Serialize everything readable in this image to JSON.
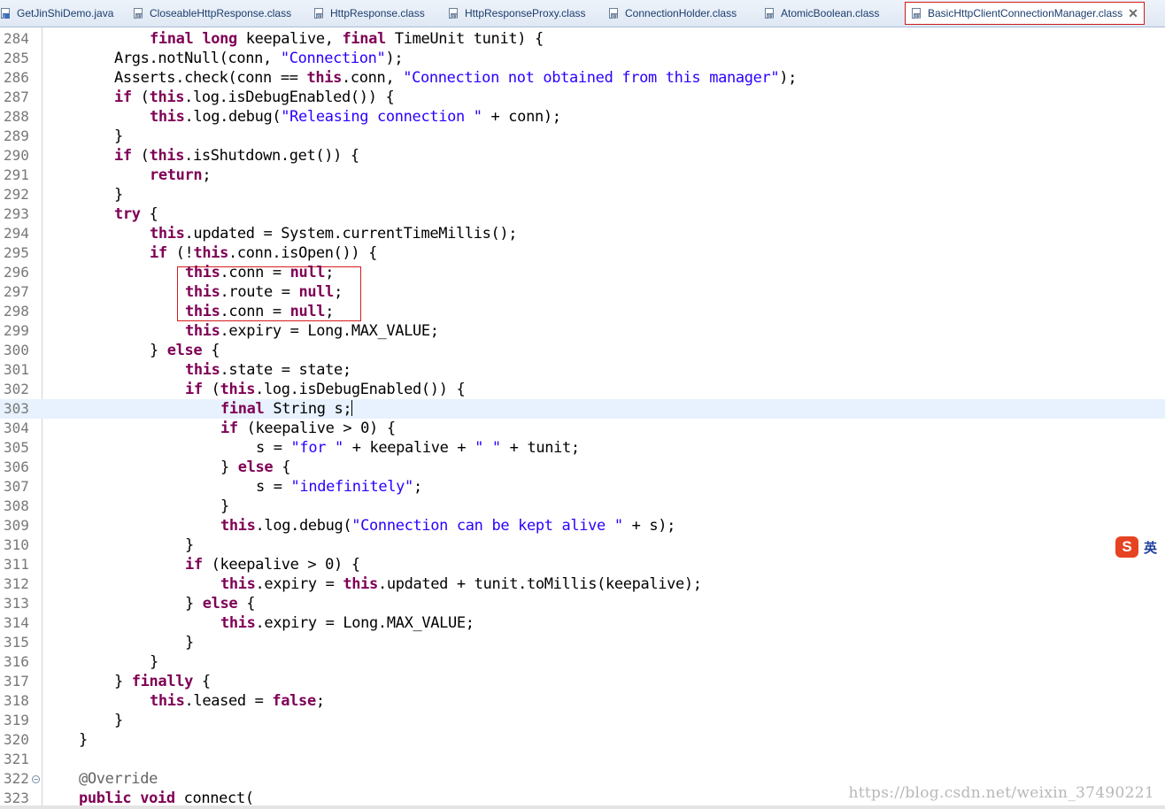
{
  "tabs": [
    {
      "label": "GetJinShiDemo.java",
      "icon": "java-file-icon",
      "active": false
    },
    {
      "label": "CloseableHttpResponse.class",
      "icon": "class-file-icon",
      "active": false
    },
    {
      "label": "HttpResponse.class",
      "icon": "class-file-icon",
      "active": false
    },
    {
      "label": "HttpResponseProxy.class",
      "icon": "class-file-icon",
      "active": false
    },
    {
      "label": "ConnectionHolder.class",
      "icon": "class-file-icon",
      "active": false
    },
    {
      "label": "AtomicBoolean.class",
      "icon": "class-file-icon",
      "active": false
    },
    {
      "label": "BasicHttpClientConnectionManager.class",
      "icon": "class-file-icon",
      "active": true,
      "close": "✕"
    }
  ],
  "editor": {
    "current_line": 303,
    "highlight_lines": [
      296,
      297,
      298
    ],
    "lines": [
      {
        "n": "284",
        "indent": 3,
        "t": [
          [
            "k",
            "final"
          ],
          [
            "p",
            " "
          ],
          [
            "k",
            "long"
          ],
          [
            "p",
            " keepalive, "
          ],
          [
            "k",
            "final"
          ],
          [
            "p",
            " TimeUnit tunit) {"
          ]
        ]
      },
      {
        "n": "285",
        "indent": 2,
        "t": [
          [
            "p",
            "Args.notNull(conn, "
          ],
          [
            "s",
            "\"Connection\""
          ],
          [
            "p",
            ");"
          ]
        ]
      },
      {
        "n": "286",
        "indent": 2,
        "t": [
          [
            "p",
            "Asserts.check(conn == "
          ],
          [
            "k",
            "this"
          ],
          [
            "p",
            ".conn, "
          ],
          [
            "s",
            "\"Connection not obtained from this manager\""
          ],
          [
            "p",
            ");"
          ]
        ]
      },
      {
        "n": "287",
        "indent": 2,
        "t": [
          [
            "k",
            "if"
          ],
          [
            "p",
            " ("
          ],
          [
            "k",
            "this"
          ],
          [
            "p",
            ".log.isDebugEnabled()) {"
          ]
        ]
      },
      {
        "n": "288",
        "indent": 3,
        "t": [
          [
            "k",
            "this"
          ],
          [
            "p",
            ".log.debug("
          ],
          [
            "s",
            "\"Releasing connection \""
          ],
          [
            "p",
            " + conn);"
          ]
        ]
      },
      {
        "n": "289",
        "indent": 2,
        "t": [
          [
            "p",
            "}"
          ]
        ]
      },
      {
        "n": "290",
        "indent": 2,
        "t": [
          [
            "k",
            "if"
          ],
          [
            "p",
            " ("
          ],
          [
            "k",
            "this"
          ],
          [
            "p",
            ".isShutdown.get()) {"
          ]
        ]
      },
      {
        "n": "291",
        "indent": 3,
        "t": [
          [
            "k",
            "return"
          ],
          [
            "p",
            ";"
          ]
        ]
      },
      {
        "n": "292",
        "indent": 2,
        "t": [
          [
            "p",
            "}"
          ]
        ]
      },
      {
        "n": "293",
        "indent": 2,
        "t": [
          [
            "k",
            "try"
          ],
          [
            "p",
            " {"
          ]
        ]
      },
      {
        "n": "294",
        "indent": 3,
        "t": [
          [
            "k",
            "this"
          ],
          [
            "p",
            ".updated = System.currentTimeMillis();"
          ]
        ]
      },
      {
        "n": "295",
        "indent": 3,
        "t": [
          [
            "k",
            "if"
          ],
          [
            "p",
            " (!"
          ],
          [
            "k",
            "this"
          ],
          [
            "p",
            ".conn.isOpen()) {"
          ]
        ]
      },
      {
        "n": "296",
        "indent": 4,
        "t": [
          [
            "k",
            "this"
          ],
          [
            "p",
            ".conn = "
          ],
          [
            "k",
            "null"
          ],
          [
            "p",
            ";"
          ]
        ]
      },
      {
        "n": "297",
        "indent": 4,
        "t": [
          [
            "k",
            "this"
          ],
          [
            "p",
            ".route = "
          ],
          [
            "k",
            "null"
          ],
          [
            "p",
            ";"
          ]
        ]
      },
      {
        "n": "298",
        "indent": 4,
        "t": [
          [
            "k",
            "this"
          ],
          [
            "p",
            ".conn = "
          ],
          [
            "k",
            "null"
          ],
          [
            "p",
            ";"
          ]
        ]
      },
      {
        "n": "299",
        "indent": 4,
        "t": [
          [
            "k",
            "this"
          ],
          [
            "p",
            ".expiry = Long.MAX_VALUE;"
          ]
        ]
      },
      {
        "n": "300",
        "indent": 3,
        "t": [
          [
            "p",
            "} "
          ],
          [
            "k",
            "else"
          ],
          [
            "p",
            " {"
          ]
        ]
      },
      {
        "n": "301",
        "indent": 4,
        "t": [
          [
            "k",
            "this"
          ],
          [
            "p",
            ".state = state;"
          ]
        ]
      },
      {
        "n": "302",
        "indent": 4,
        "t": [
          [
            "k",
            "if"
          ],
          [
            "p",
            " ("
          ],
          [
            "k",
            "this"
          ],
          [
            "p",
            ".log.isDebugEnabled()) {"
          ]
        ]
      },
      {
        "n": "303",
        "indent": 5,
        "t": [
          [
            "k",
            "final"
          ],
          [
            "p",
            " String s;"
          ]
        ]
      },
      {
        "n": "304",
        "indent": 5,
        "t": [
          [
            "k",
            "if"
          ],
          [
            "p",
            " (keepalive > 0) {"
          ]
        ]
      },
      {
        "n": "305",
        "indent": 6,
        "t": [
          [
            "p",
            "s = "
          ],
          [
            "s",
            "\"for \""
          ],
          [
            "p",
            " + keepalive + "
          ],
          [
            "s",
            "\" \""
          ],
          [
            "p",
            " + tunit;"
          ]
        ]
      },
      {
        "n": "306",
        "indent": 5,
        "t": [
          [
            "p",
            "} "
          ],
          [
            "k",
            "else"
          ],
          [
            "p",
            " {"
          ]
        ]
      },
      {
        "n": "307",
        "indent": 6,
        "t": [
          [
            "p",
            "s = "
          ],
          [
            "s",
            "\"indefinitely\""
          ],
          [
            "p",
            ";"
          ]
        ]
      },
      {
        "n": "308",
        "indent": 5,
        "t": [
          [
            "p",
            "}"
          ]
        ]
      },
      {
        "n": "309",
        "indent": 5,
        "t": [
          [
            "k",
            "this"
          ],
          [
            "p",
            ".log.debug("
          ],
          [
            "s",
            "\"Connection can be kept alive \""
          ],
          [
            "p",
            " + s);"
          ]
        ]
      },
      {
        "n": "310",
        "indent": 4,
        "t": [
          [
            "p",
            "}"
          ]
        ]
      },
      {
        "n": "311",
        "indent": 4,
        "t": [
          [
            "k",
            "if"
          ],
          [
            "p",
            " (keepalive > 0) {"
          ]
        ]
      },
      {
        "n": "312",
        "indent": 5,
        "t": [
          [
            "k",
            "this"
          ],
          [
            "p",
            ".expiry = "
          ],
          [
            "k",
            "this"
          ],
          [
            "p",
            ".updated + tunit.toMillis(keepalive);"
          ]
        ]
      },
      {
        "n": "313",
        "indent": 4,
        "t": [
          [
            "p",
            "} "
          ],
          [
            "k",
            "else"
          ],
          [
            "p",
            " {"
          ]
        ]
      },
      {
        "n": "314",
        "indent": 5,
        "t": [
          [
            "k",
            "this"
          ],
          [
            "p",
            ".expiry = Long.MAX_VALUE;"
          ]
        ]
      },
      {
        "n": "315",
        "indent": 4,
        "t": [
          [
            "p",
            "}"
          ]
        ]
      },
      {
        "n": "316",
        "indent": 3,
        "t": [
          [
            "p",
            "}"
          ]
        ]
      },
      {
        "n": "317",
        "indent": 2,
        "t": [
          [
            "p",
            "} "
          ],
          [
            "k",
            "finally"
          ],
          [
            "p",
            " {"
          ]
        ]
      },
      {
        "n": "318",
        "indent": 3,
        "t": [
          [
            "k",
            "this"
          ],
          [
            "p",
            ".leased = "
          ],
          [
            "k",
            "false"
          ],
          [
            "p",
            ";"
          ]
        ]
      },
      {
        "n": "319",
        "indent": 2,
        "t": [
          [
            "p",
            "}"
          ]
        ]
      },
      {
        "n": "320",
        "indent": 1,
        "t": [
          [
            "p",
            "}"
          ]
        ]
      },
      {
        "n": "321",
        "indent": 0,
        "t": []
      },
      {
        "n": "322",
        "indent": 1,
        "fold": "−",
        "t": [
          [
            "a",
            "@Override"
          ]
        ]
      },
      {
        "n": "323",
        "indent": 1,
        "t": [
          [
            "k",
            "public"
          ],
          [
            "p",
            " "
          ],
          [
            "k",
            "void"
          ],
          [
            "p",
            " connect("
          ]
        ]
      }
    ]
  },
  "ime": {
    "logo": "S",
    "lang": "英"
  },
  "watermark": "https://blog.csdn.net/weixin_37490221"
}
